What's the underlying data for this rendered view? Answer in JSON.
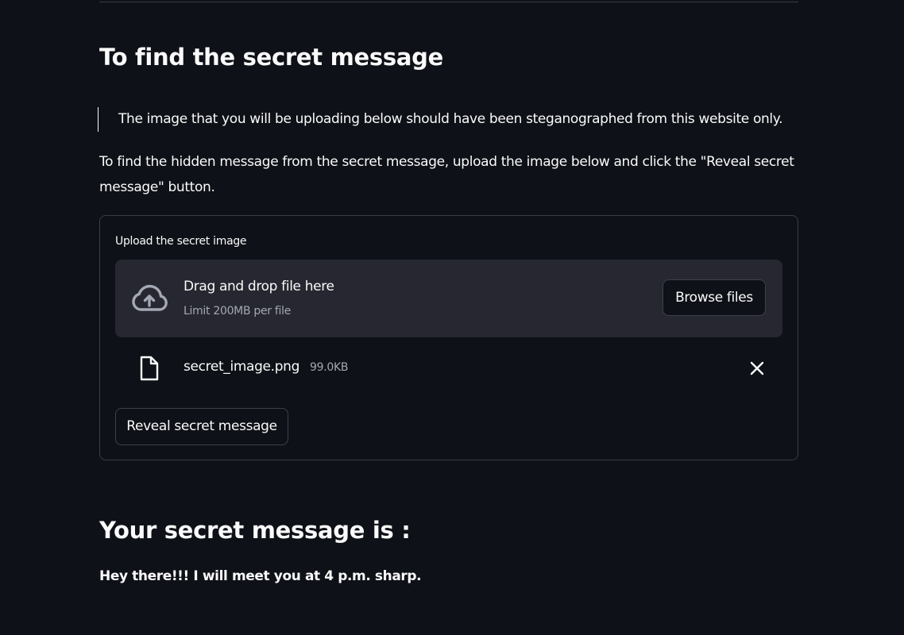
{
  "page": {
    "section_title": "To find the secret message",
    "note": "The image that you will be uploading below should have been steganographed from this website only.",
    "instructions": "To find the hidden message from the secret message, upload the image below and click the \"Reveal secret message\" button."
  },
  "uploader": {
    "label": "Upload the secret image",
    "dropzone_title": "Drag and drop file here",
    "dropzone_limit": "Limit 200MB per file",
    "browse_label": "Browse files",
    "cloud_icon": "cloud-upload-icon",
    "file": {
      "name": "secret_image.png",
      "size": "99.0KB",
      "icon": "file-icon",
      "remove_icon": "close-icon"
    }
  },
  "actions": {
    "reveal_label": "Reveal secret message"
  },
  "result": {
    "title": "Your secret message is :",
    "message": "Hey there!!! I will meet you at 4 p.m. sharp."
  },
  "colors": {
    "background": "#0e1117",
    "dropzone": "#262730",
    "text": "#fafafa",
    "muted_text": "#a3a8b4",
    "border": "#3a3d46"
  }
}
